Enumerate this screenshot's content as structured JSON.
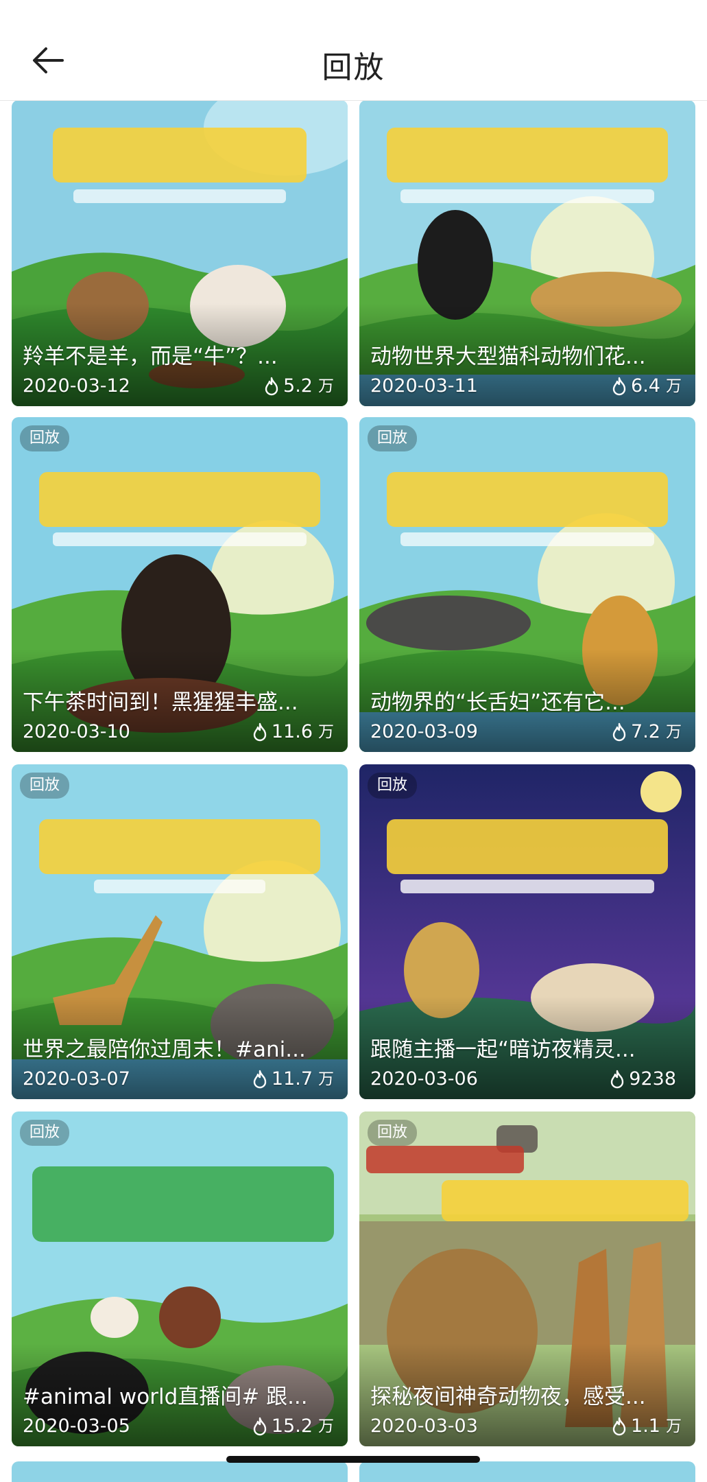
{
  "header": {
    "title": "回放",
    "back_icon": "arrow-left-icon"
  },
  "badge_label": "回放",
  "cards": [
    {
      "title": "羚羊不是羊，而是“牛”？...",
      "date": "2020-03-12",
      "views": "5.2",
      "unit": "万",
      "theme": "#7fcbe0"
    },
    {
      "title": "动物世界大型猫科动物们花...",
      "date": "2020-03-11",
      "views": "6.4",
      "unit": "万",
      "theme": "#8fd3e5"
    },
    {
      "title": "下午茶时间到！黑猩猩丰盛...",
      "date": "2020-03-10",
      "views": "11.6",
      "unit": "万",
      "theme": "#7fd0e6"
    },
    {
      "title": "动物界的“长舌妇”还有它...",
      "date": "2020-03-09",
      "views": "7.2",
      "unit": "万",
      "theme": "#88d4e6"
    },
    {
      "title": "世界之最陪你过周末！#ani...",
      "date": "2020-03-07",
      "views": "11.7",
      "unit": "万",
      "theme": "#8fd6e8"
    },
    {
      "title": "跟随主播一起“暗访夜精灵...",
      "date": "2020-03-06",
      "views": "9238",
      "unit": "",
      "theme": "#2a2f7a"
    },
    {
      "title": "#animal world直播间# 跟...",
      "date": "2020-03-05",
      "views": "15.2",
      "unit": "万",
      "theme": "#94dbe9"
    },
    {
      "title": "探秘夜间神奇动物夜，感受...",
      "date": "2020-03-03",
      "views": "1.1",
      "unit": "万",
      "theme": "#9ab77a"
    }
  ]
}
